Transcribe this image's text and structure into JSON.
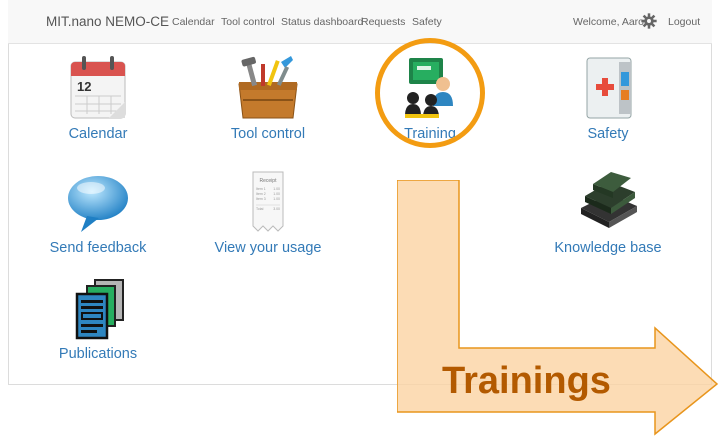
{
  "navbar": {
    "brand": "MIT.nano NEMO-CE",
    "links": [
      "Calendar",
      "Tool control",
      "Status dashboard",
      "Requests",
      "Safety"
    ],
    "welcome": "Welcome, Aaron",
    "logout": "Logout"
  },
  "tiles": {
    "calendar": {
      "label": "Calendar",
      "icon": "calendar-icon",
      "day": "12"
    },
    "tool_control": {
      "label": "Tool control",
      "icon": "toolbox-icon"
    },
    "training": {
      "label": "Training",
      "icon": "training-icon"
    },
    "safety": {
      "label": "Safety",
      "icon": "first-aid-cabinet-icon"
    },
    "send_feedback": {
      "label": "Send feedback",
      "icon": "speech-bubble-icon"
    },
    "view_usage": {
      "label": "View your usage",
      "icon": "receipt-icon",
      "receipt": {
        "title": "Receipt",
        "lines": [
          [
            "Item 1",
            "1.00"
          ],
          [
            "Item 2",
            "1.00"
          ],
          [
            "Item 3",
            "1.00"
          ]
        ],
        "total": [
          "Total",
          "3.00"
        ]
      }
    },
    "knowledge_base": {
      "label": "Knowledge base",
      "icon": "books-icon"
    },
    "publications": {
      "label": "Publications",
      "icon": "documents-icon"
    }
  },
  "overlay": {
    "callout_text": "Trainings",
    "highlight_color": "#f39c12",
    "arrow_fill": "#fbd3a3",
    "text_color": "#b35a00"
  }
}
